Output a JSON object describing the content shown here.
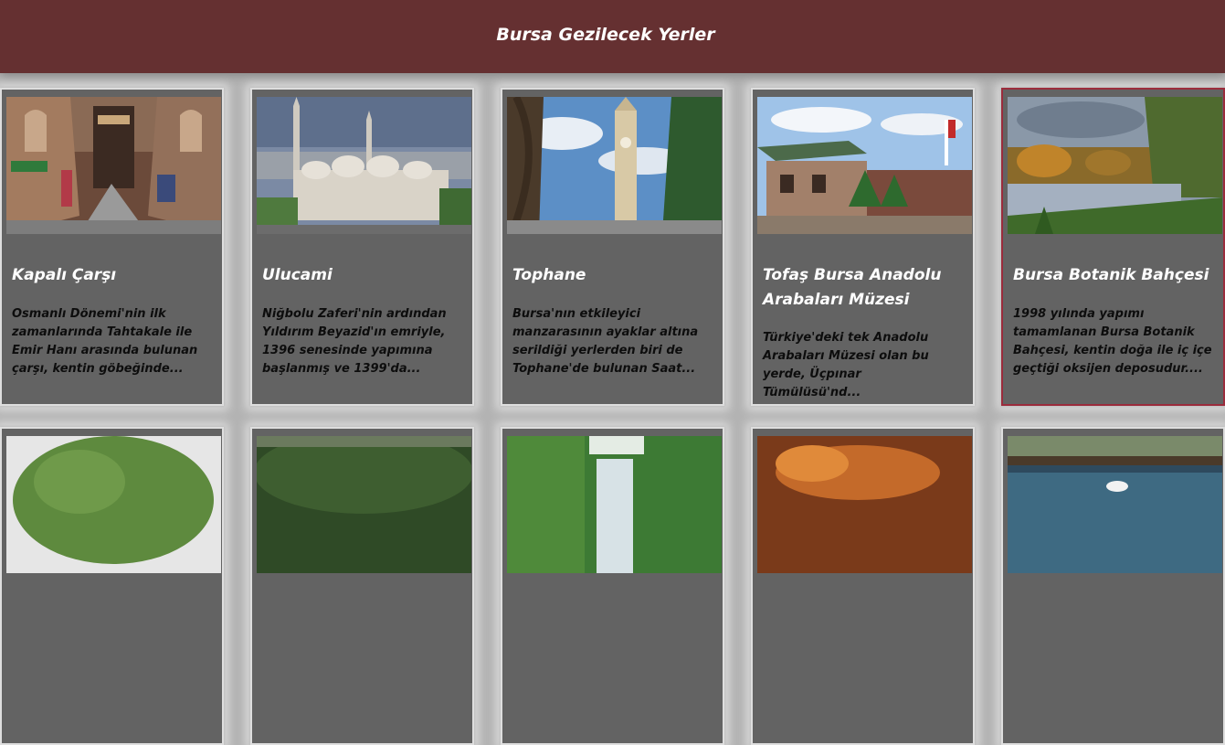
{
  "header": {
    "title": "Bursa Gezilecek Yerler"
  },
  "cards": [
    {
      "title": "Kapalı Çarşı",
      "description": "Osmanlı Dönemi'nin ilk zamanlarında Tahtakale ile Emir Hanı arasında bulunan çarşı, kentin göbeğinde..."
    },
    {
      "title": "Ulucami",
      "description": "Niğbolu Zaferi'nin ardından Yıldırım Beyazid'ın emriyle, 1396 senesinde yapımına başlanmış ve 1399'da..."
    },
    {
      "title": "Tophane",
      "description": "Bursa'nın etkileyici manzarasının ayaklar altına serildiği yerlerden biri de Tophane'de bulunan Saat..."
    },
    {
      "title": "Tofaş Bursa Anadolu Arabaları Müzesi",
      "description": "Türkiye'deki tek Anadolu Arabaları Müzesi olan bu yerde, Üçpınar Tümülüsü'nd..."
    },
    {
      "title": "Bursa Botanik Bahçesi",
      "description": "1998 yılında yapımı tamamlanan Bursa Botanik Bahçesi, kentin doğa ile iç içe geçtiği oksijen deposudur...."
    }
  ],
  "colors": {
    "header_bg": "#653031",
    "page_bg": "#b3b3b3",
    "card_bg": "#636363",
    "active_border": "#9b2c3c"
  }
}
